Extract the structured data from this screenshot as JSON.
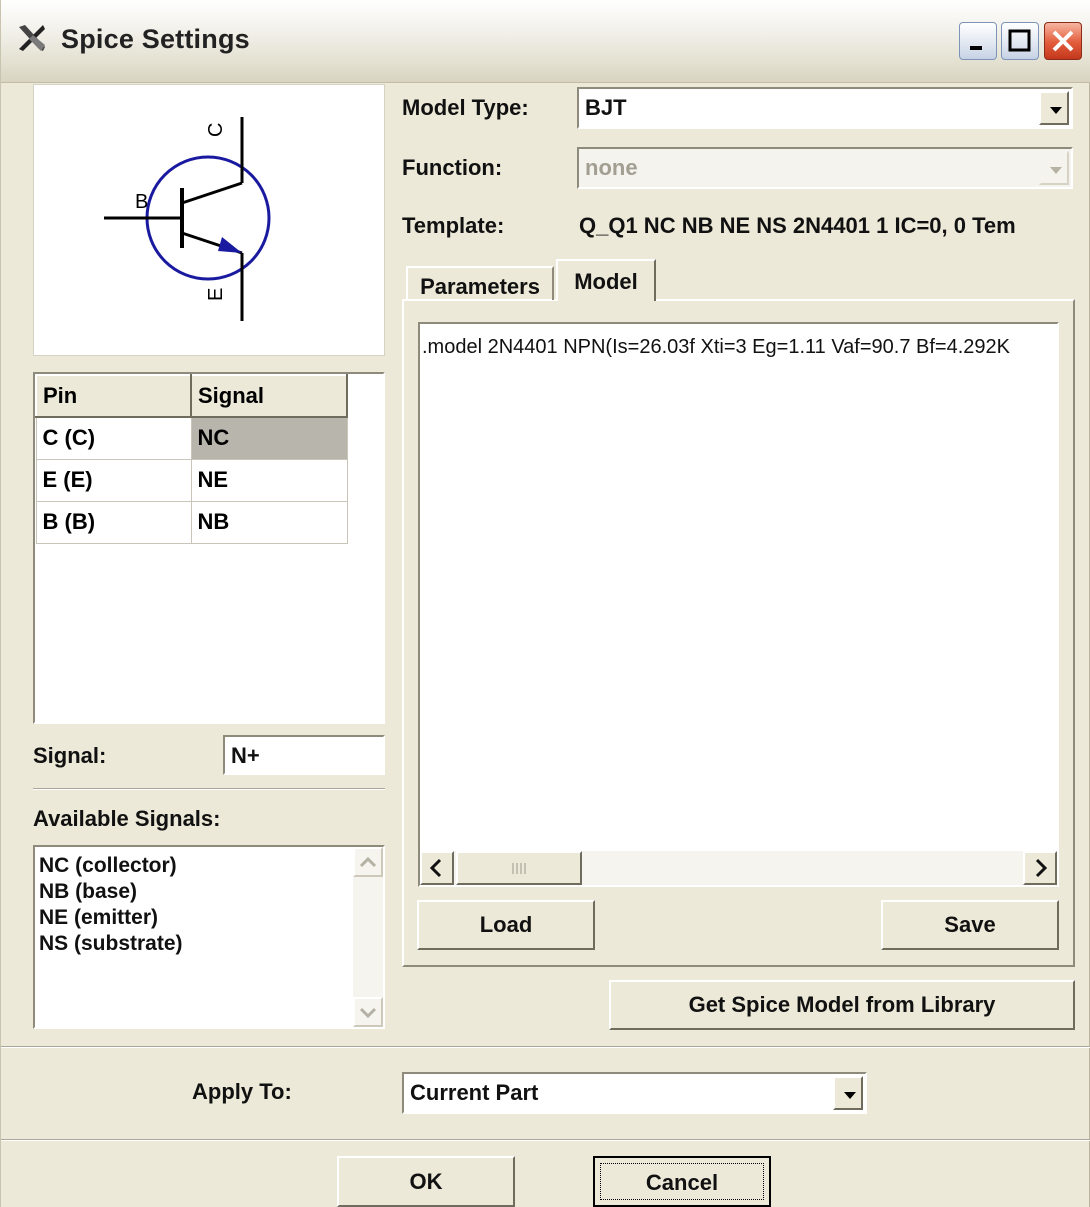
{
  "window": {
    "title": "Spice Settings"
  },
  "symbol": {
    "pin_c": "C",
    "pin_b": "B",
    "pin_e": "E"
  },
  "pin_table": {
    "headers": [
      "Pin",
      "Signal"
    ],
    "rows": [
      {
        "pin": "C (C)",
        "signal": "NC"
      },
      {
        "pin": "E (E)",
        "signal": "NE"
      },
      {
        "pin": "B (B)",
        "signal": "NB"
      }
    ]
  },
  "signal": {
    "label": "Signal:",
    "value": "N+"
  },
  "available_signals": {
    "label": "Available Signals:",
    "items": [
      "NC (collector)",
      "NB (base)",
      "NE (emitter)",
      "NS (substrate)"
    ]
  },
  "model_type": {
    "label": "Model Type:",
    "value": "BJT"
  },
  "function": {
    "label": "Function:",
    "value": "none"
  },
  "template": {
    "label": "Template:",
    "value": "Q_Q1 NC NB NE NS 2N4401 1 IC=0, 0 Tem"
  },
  "tabs": {
    "parameters": "Parameters",
    "model": "Model"
  },
  "model_text": ".model 2N4401 NPN(Is=26.03f Xti=3 Eg=1.11 Vaf=90.7 Bf=4.292K",
  "buttons": {
    "load": "Load",
    "save": "Save",
    "get_spice_model": "Get Spice Model from Library",
    "ok": "OK",
    "cancel": "Cancel"
  },
  "apply_to": {
    "label": "Apply To:",
    "value": "Current Part"
  },
  "colors": {
    "symbol_stroke": "#1a1aa0",
    "selected_cell": "#b8b5ad"
  }
}
